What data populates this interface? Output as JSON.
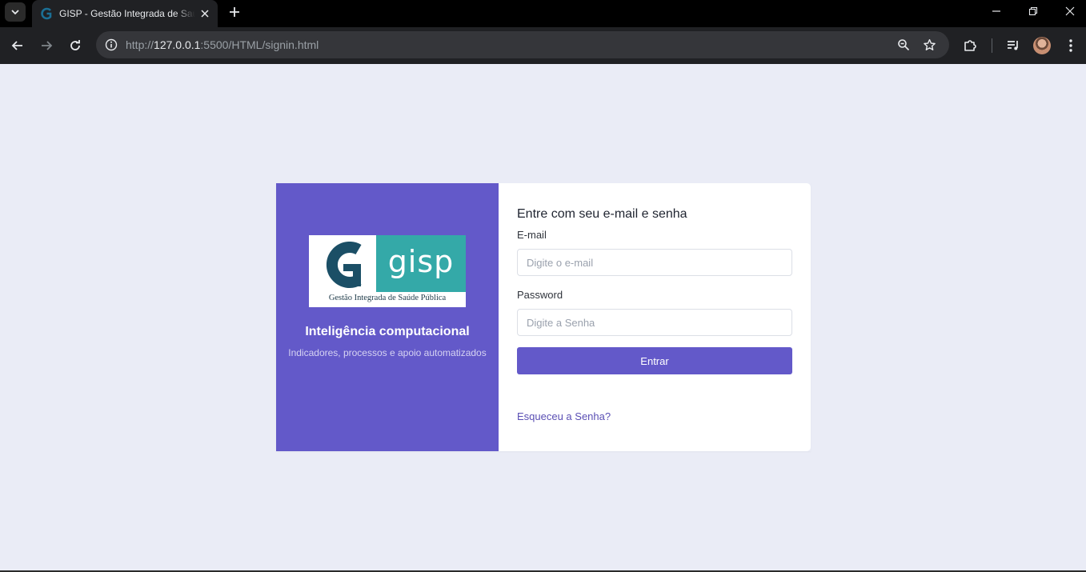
{
  "browser": {
    "tab": {
      "title": "GISP - Gestão Integrada de Saúde Pública"
    },
    "address_bar": {
      "url_scheme": "http://",
      "url_host": "127.0.0.1",
      "url_rest": ":5500/HTML/signin.html"
    },
    "icons": {
      "tab_search": "chevron-down-icon",
      "favicon": "gisp-g-icon",
      "close": "close-icon",
      "new_tab": "plus-icon",
      "minimize": "minimize-icon",
      "restore": "restore-icon",
      "window_close": "close-icon",
      "back": "arrow-left-icon",
      "forward": "arrow-right-icon",
      "reload": "reload-icon",
      "site_info": "info-icon",
      "zoom": "zoom-icon",
      "bookmark": "star-icon",
      "extensions": "puzzle-icon",
      "media": "media-queue-icon",
      "menu": "kebab-menu-icon"
    }
  },
  "brand": {
    "logo": {
      "wordmark": "gisp",
      "tagline": "Gestão Integrada de Saúde Pública"
    },
    "title": "Inteligência computacional",
    "subtitle": "Indicadores, processos e apoio automatizados"
  },
  "login": {
    "heading": "Entre com seu e-mail e senha",
    "email": {
      "label": "E-mail",
      "placeholder": "Digite o e-mail",
      "value": ""
    },
    "password": {
      "label": "Password",
      "placeholder": "Digite a Senha",
      "value": ""
    },
    "submit_label": "Entrar",
    "forgot_label": "Esqueceu a Senha?"
  },
  "colors": {
    "brand_purple": "#6359c9",
    "logo_teal": "#34a9a8",
    "logo_navy": "#1b4f66",
    "page_background": "#eaecf6",
    "link": "#5a4fb4"
  }
}
